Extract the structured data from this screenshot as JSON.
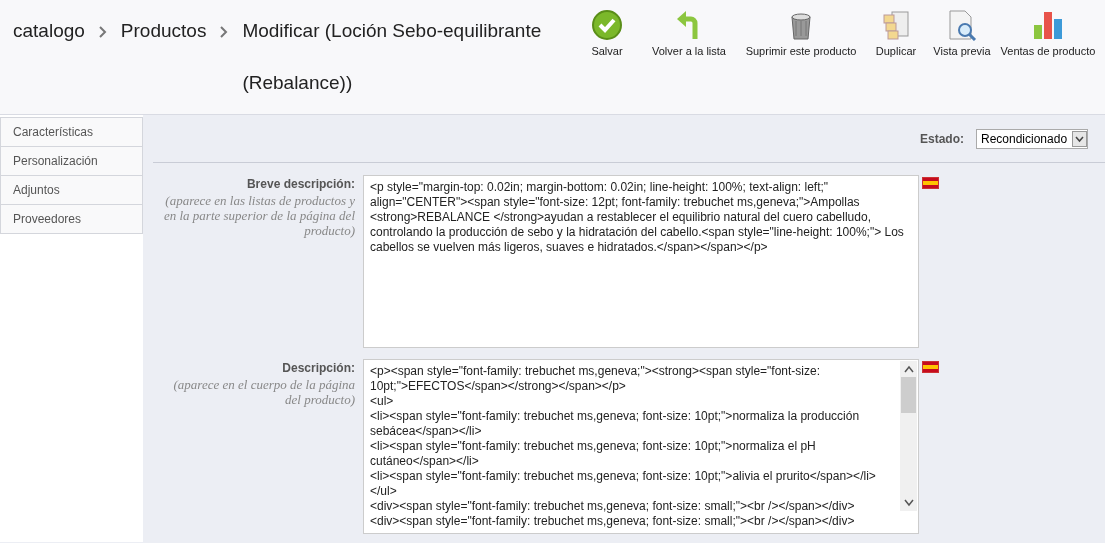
{
  "breadcrumb": [
    "catalogo",
    "Productos",
    "Modificar (Loción Sebo-equilibrante (Rebalance))"
  ],
  "toolbar": [
    {
      "kind": "check",
      "label": "Salvar"
    },
    {
      "kind": "back",
      "label": "Volver a la lista"
    },
    {
      "kind": "trash",
      "label": "Suprimir este producto"
    },
    {
      "kind": "copy",
      "label": "Duplicar"
    },
    {
      "kind": "preview",
      "label": "Vista previa"
    },
    {
      "kind": "chart",
      "label": "Ventas de producto"
    }
  ],
  "sidebar": {
    "items": [
      {
        "label": "Características"
      },
      {
        "label": "Personalización"
      },
      {
        "label": "Adjuntos"
      },
      {
        "label": "Proveedores"
      }
    ]
  },
  "estado": {
    "label": "Estado:",
    "value": "Recondicionado"
  },
  "fields": [
    {
      "label": "Breve descripción:",
      "note": "(aparece en las listas de productos y en la parte superior de la página del producto)",
      "value": "<p style=\"margin-top: 0.02in; margin-bottom: 0.02in; line-height: 100%; text-align: left;\" align=\"CENTER\"><span style=\"font-size: 12pt; font-family: trebuchet ms,geneva;\">Ampollas <strong>REBALANCE </strong>ayudan a restablecer el equilibrio natural del cuero cabelludo, controlando la producción de sebo y la hidratación del cabello.<span style=\"line-height: 100%;\"> Los cabellos se vuelven más ligeros, suaves e hidratados.</span></span></p>",
      "scrollbar": false
    },
    {
      "label": "Descripción:",
      "note": "(aparece en el cuerpo de la página del producto)",
      "value": "<p><span style=\"font-family: trebuchet ms,geneva;\"><strong><span style=\"font-size: 10pt;\">EFECTOS</span></strong></span></p>\n<ul>\n<li><span style=\"font-family: trebuchet ms,geneva; font-size: 10pt;\">normaliza la producción sebácea</span></li>\n<li><span style=\"font-family: trebuchet ms,geneva; font-size: 10pt;\">normaliza el pH cutáneo</span></li>\n<li><span style=\"font-family: trebuchet ms,geneva; font-size: 10pt;\">alivia el prurito</span></li>\n</ul>\n<div><span style=\"font-family: trebuchet ms,geneva; font-size: small;\"><br /></span></div>\n<div><span style=\"font-family: trebuchet ms,geneva; font-size: small;\"><br /></span></div>",
      "scrollbar": true
    }
  ]
}
